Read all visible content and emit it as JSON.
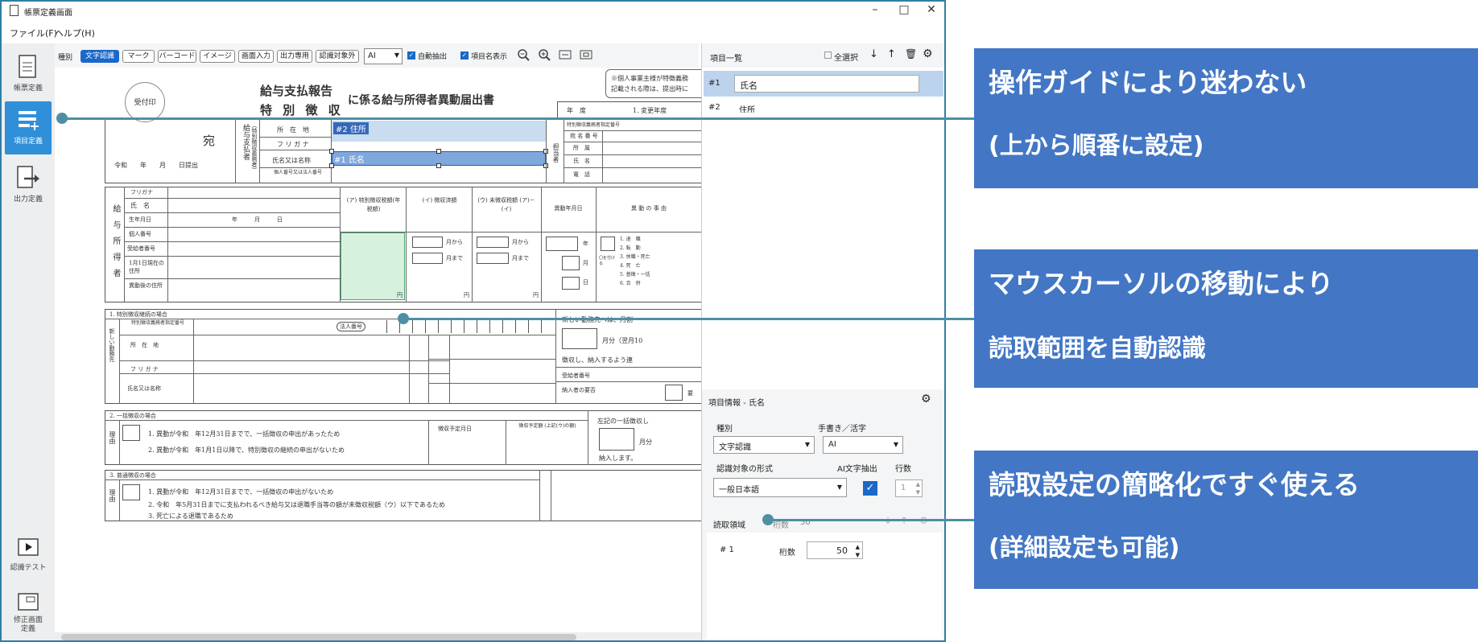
{
  "window": {
    "title": "帳票定義画面"
  },
  "menu": [
    "ファイル(F)",
    "ヘルプ(H)"
  ],
  "leftnav": [
    {
      "label": "帳票定義"
    },
    {
      "label": "項目定義"
    },
    {
      "label": "出力定義"
    },
    {
      "label": "認識テスト"
    },
    {
      "label": "修正画面定義"
    }
  ],
  "toolbar": {
    "type_label": "種別",
    "buttons": [
      "文字認識",
      "マーク",
      "バーコード",
      "イメージ",
      "画面入力",
      "出力専用",
      "認識対象外"
    ],
    "select_value": "AI",
    "check_auto": "自動抽出",
    "check_names": "項目名表示"
  },
  "doc": {
    "stamp": "受付印",
    "title1": "給与支払報告",
    "title2": "特 別 徴 収",
    "title3": "に係る給与所得者異動届出書",
    "notice1": "※個人事業主様が特徴義務",
    "notice2": "記載される際は、提出時に",
    "nendo": "年　度",
    "henko": "1. 変更年度",
    "atena": "宛",
    "reiwa": "令和　　年　　月　　日提出",
    "payer_side": "給与支払者",
    "payer_sub": "（特別徴収義務者）",
    "payer_rows": [
      "所　在　地",
      "フ リ ガ ナ",
      "氏名又は名称",
      "個人番号又は法人番号"
    ],
    "tag1": "#2 住所",
    "tag2": "#1 氏名",
    "right_rows": [
      "特別徴収義務者指定番号",
      "宛 名 番 号",
      "所　属",
      "氏　名",
      "電　話"
    ],
    "right_side": "担当者",
    "emp_side": "給与所得者",
    "emp_rows": [
      "フリガナ",
      "氏　名",
      "生年月日",
      "個人番号",
      "受給者番号",
      "1月1日現在の住所",
      "異動後の住所"
    ],
    "birth": "年　　　月　　　日",
    "col_heads": [
      "(ア) 特別徴収税額(年税額)",
      "(イ) 徴収済額",
      "(ウ) 未徴収税額 (ア)－(イ)",
      "異動年月日",
      "異 動 の 事 由"
    ],
    "from": "月から",
    "to": "月まで",
    "yen": "円",
    "nen": "年",
    "tsuki": "月",
    "hi": "日",
    "reasons": [
      "1. 退　職",
      "2. 転　勤",
      "3. 休職・死亡",
      "4. 死　亡",
      "5. 普徴・一括",
      "6. 合　併"
    ],
    "sec1": "1. 特別徴収継続の場合",
    "sec1_rows": [
      "特別徴収義務者指定番号",
      "所　在　地",
      "フ リ ガ ナ",
      "氏名又は名称"
    ],
    "sec1_side": "新しい勤務先",
    "sec1_kotei": "法人番号",
    "sec1_new": "新しい勤務先へは、月割",
    "sec1_month": "月分（翌月10",
    "sec1_pay": "徴収し、納入するよう連",
    "sec1_recv": "受給者番号",
    "sec1_due": "納入者の要否",
    "sec1_mark": "要",
    "sec2": "2. 一括徴収の場合",
    "sec2_r1": "1. 異動が令和　年12月31日までで、一括徴収の申出があったため",
    "sec2_r2": "2. 異動が令和　年1月1日以降で、特別徴収の継続の申出がないため",
    "sec2_plan": "徴収予定月日",
    "sec2_amt": "徴収予定額 (上記(ウ)の額)",
    "sec2_note": "左記の一括徴収し",
    "sec2_month": "月分",
    "sec2_pay": "納入します。",
    "sec3": "3. 普通徴収の場合",
    "sec3_r1": "1. 異動が令和　年12月31日までで、一括徴収の申出がないため",
    "sec3_r2": "2. 令和　年5月31日までに支払われるべき給与又は退職手当等の額が未徴収税額（ウ）以下であるため",
    "sec3_r3": "3. 死亡による退職であるため",
    "riyu": "理由",
    "marker": "〇を付ける"
  },
  "rightpanel": {
    "list_title": "項目一覧",
    "select_all": "全選択",
    "items": [
      {
        "no": "#1",
        "name": "氏名"
      },
      {
        "no": "#2",
        "name": "住所"
      }
    ],
    "info_title": "項目情報 - 氏名",
    "type_label": "種別",
    "type_value": "文字認識",
    "hand_label": "手書き／活字",
    "hand_value": "AI",
    "format_label": "認識対象の形式",
    "format_value": "一般日本語",
    "ai_label": "AI文字抽出",
    "lines_label": "行数",
    "lines_value": "1",
    "area_label": "読取領域",
    "area_count_label": "桁数",
    "area_count_value": "50",
    "row_no": "# 1",
    "row_label": "桁数",
    "row_value": "50"
  },
  "callouts": [
    {
      "l1": "操作ガイドにより迷わない",
      "l2": "(上から順番に設定)"
    },
    {
      "l1": "マウスカーソルの移動により",
      "l2": "読取範囲を自動認識"
    },
    {
      "l1": "読取設定の簡略化ですぐ使える",
      "l2": "(詳細設定も可能)"
    }
  ],
  "colors": {
    "accent": "#4377c5",
    "line": "#4f8fa3",
    "select": "#1a68c8",
    "highlight": "#c9dcf0",
    "green": "#d6f2df"
  }
}
